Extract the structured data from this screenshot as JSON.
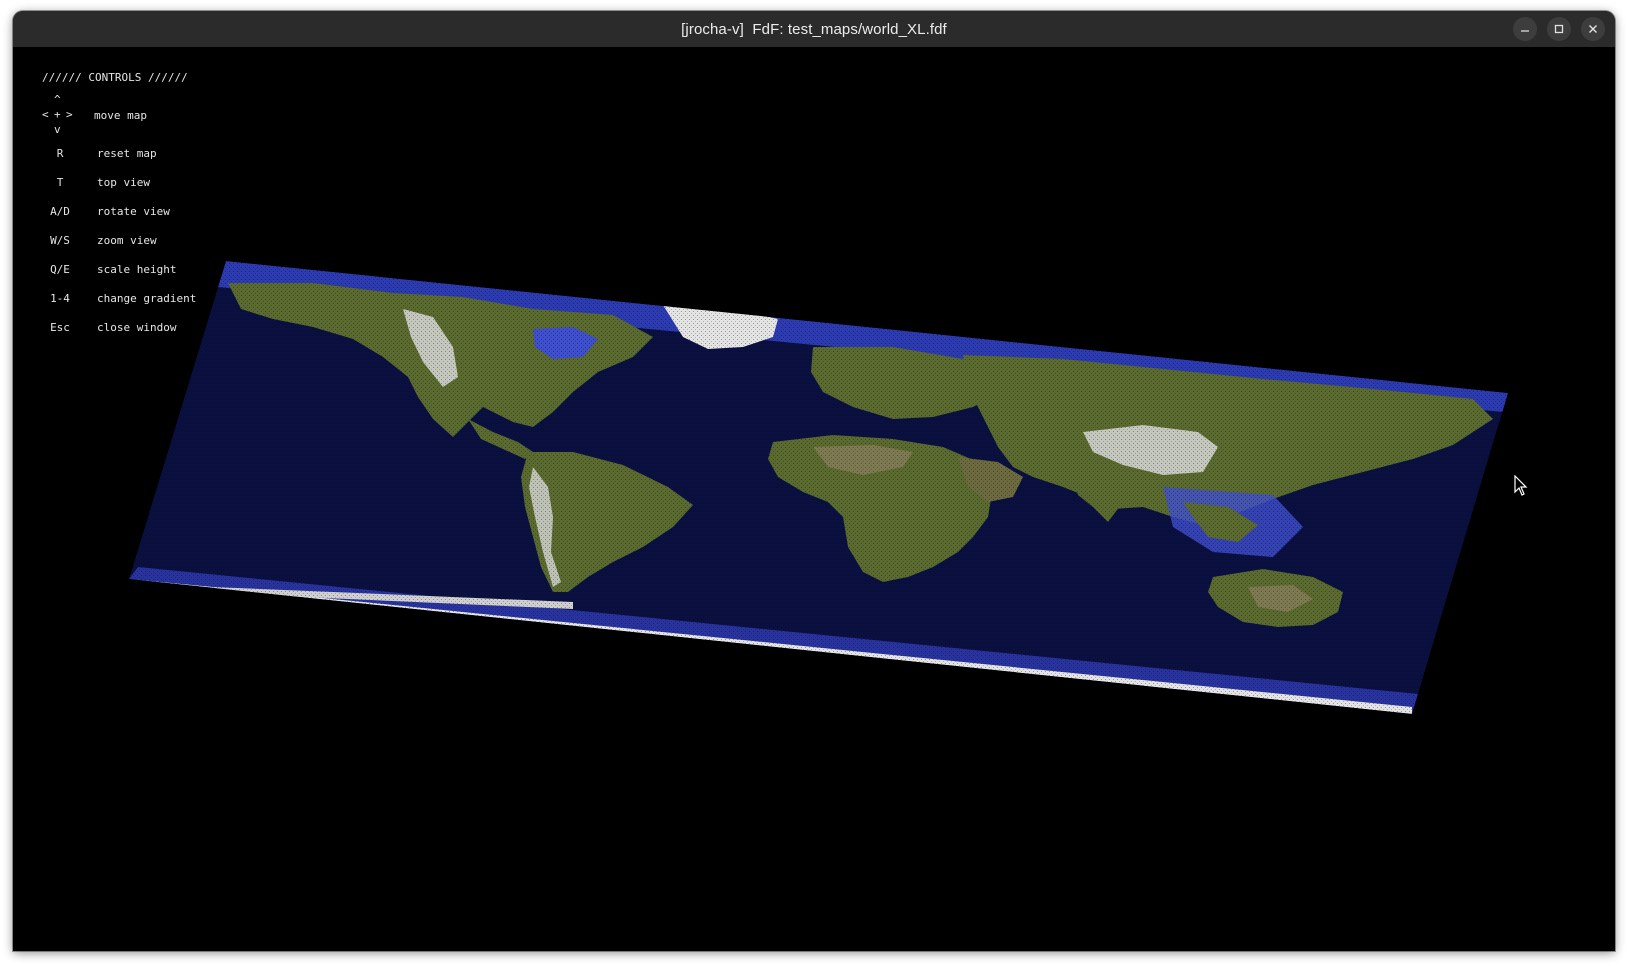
{
  "window": {
    "title": "[jrocha-v]  FdF: test_maps/world_XL.fdf",
    "buttons": [
      "minimize-icon",
      "maximize-icon",
      "close-icon"
    ]
  },
  "controls": {
    "header": "////// CONTROLS //////",
    "move": {
      "up": "^",
      "left": "<",
      "center": "+",
      "right": ">",
      "down": "v",
      "label": "move map"
    },
    "items": [
      {
        "key": "R",
        "label": "reset map"
      },
      {
        "key": "T",
        "label": "top view"
      },
      {
        "key": "A/D",
        "label": "rotate view"
      },
      {
        "key": "W/S",
        "label": "zoom view"
      },
      {
        "key": "Q/E",
        "label": "scale height"
      },
      {
        "key": "1-4",
        "label": "change gradient"
      },
      {
        "key": "Esc",
        "label": "close window"
      }
    ]
  },
  "map": {
    "colors": {
      "deep_ocean": "#0a1040",
      "shallow_water": "#3e4fcf",
      "lowland": "#5b6a2e",
      "highland": "#7e7a52",
      "snow": "#d8d8d8"
    }
  }
}
